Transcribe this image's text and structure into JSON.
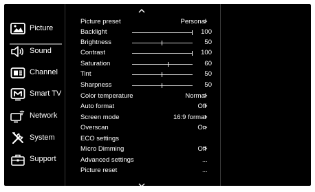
{
  "sidebar": {
    "items": [
      {
        "label": "Picture",
        "icon": "picture-icon",
        "active": true
      },
      {
        "label": "Sound",
        "icon": "speaker-icon",
        "active": false
      },
      {
        "label": "Channel",
        "icon": "channel-icon",
        "active": false
      },
      {
        "label": "Smart TV",
        "icon": "smart-tv-icon",
        "active": false
      },
      {
        "label": "Network",
        "icon": "network-icon",
        "active": false
      },
      {
        "label": "System",
        "icon": "tools-icon",
        "active": false
      },
      {
        "label": "Support",
        "icon": "support-icon",
        "active": false
      }
    ]
  },
  "settings": {
    "rows": [
      {
        "label": "Picture preset",
        "value": "Personal",
        "arrow": ">"
      },
      {
        "label": "Backlight",
        "slider": 100,
        "number": "100"
      },
      {
        "label": "Brightness",
        "slider": 50,
        "number": "50"
      },
      {
        "label": "Contrast",
        "slider": 100,
        "number": "100"
      },
      {
        "label": "Saturation",
        "slider": 60,
        "number": "60"
      },
      {
        "label": "Tint",
        "slider": 50,
        "number": "50"
      },
      {
        "label": "Sharpness",
        "slider": 50,
        "number": "50"
      },
      {
        "label": "Color temperature",
        "value": "Normal",
        "arrow": ">"
      },
      {
        "label": "Auto format",
        "value": "Off",
        "arrow": ">"
      },
      {
        "label": "Screen mode",
        "value": "16:9 format",
        "arrow": ">"
      },
      {
        "label": "Overscan",
        "value": "On",
        "arrow": ">"
      },
      {
        "label": "ECO settings"
      },
      {
        "label": "Micro Dimming",
        "value": "Off",
        "arrow": ">"
      },
      {
        "label": "Advanced settings",
        "ellipsis": "..."
      },
      {
        "label": "Picture reset",
        "ellipsis": "..."
      }
    ]
  },
  "colors": {
    "background": "#000000",
    "text": "#ffffff",
    "divider": "#3a3a3a",
    "active_underline": "#7a7a7a"
  }
}
